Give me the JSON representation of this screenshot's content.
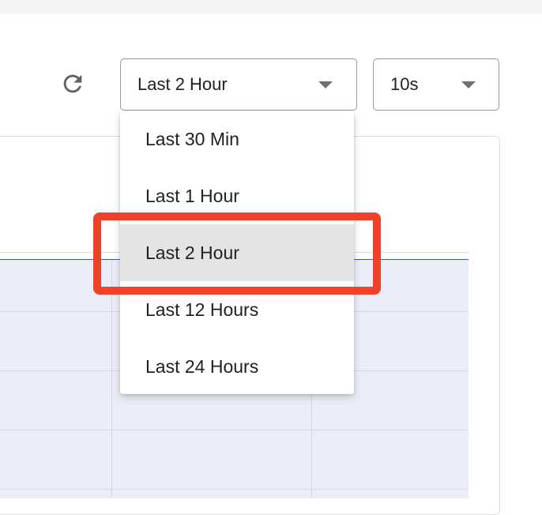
{
  "toolbar": {
    "refresh_icon": "refresh-icon",
    "time_range": {
      "value": "Last 2 Hour"
    },
    "refresh_interval": {
      "value": "10s"
    }
  },
  "time_range_menu": {
    "items": [
      {
        "label": "Last 30 Min"
      },
      {
        "label": "Last 1 Hour"
      },
      {
        "label": "Last 2 Hour",
        "selected": true
      },
      {
        "label": "Last 12 Hours"
      },
      {
        "label": "Last 24 Hours"
      }
    ]
  },
  "colors": {
    "highlight": "#ee4229",
    "series_line": "#3d55b8",
    "plot_fill": "#ebedf8",
    "selected_item_bg": "#e4e4e4"
  }
}
